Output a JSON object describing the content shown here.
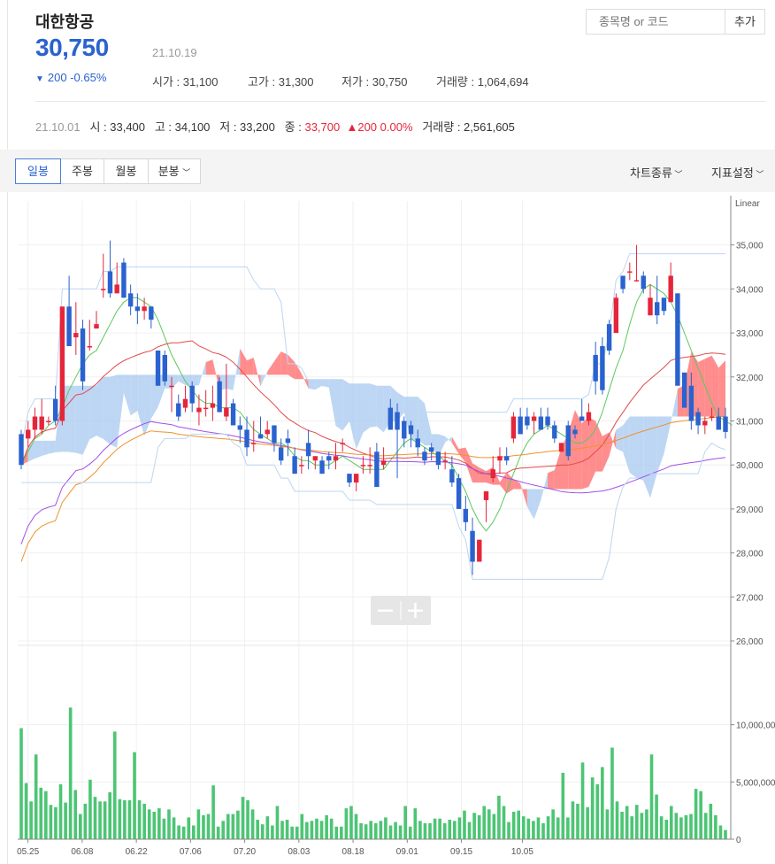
{
  "header": {
    "stock_name": "대한항공",
    "price": "30,750",
    "date": "21.10.19",
    "change": "200 -0.65%",
    "open": "시가 : 31,100",
    "high": "고가 : 31,300",
    "low": "저가 : 30,750",
    "volume": "거래량 : 1,064,694"
  },
  "search": {
    "placeholder": "종목명 or 코드",
    "add_label": "추가"
  },
  "daily": {
    "date": "21.10.01",
    "open": "시 : 33,400",
    "high": "고 : 34,100",
    "low": "저 : 33,200",
    "close_label": "종 : ",
    "close_value": "33,700",
    "change": "▲200 0.00%",
    "volume": "거래량 : 2,561,605"
  },
  "tabs": [
    "일봉",
    "주봉",
    "월봉",
    "분봉"
  ],
  "active_tab": 0,
  "menus": {
    "chart_type": "차트종류",
    "indicator": "지표설정"
  },
  "icons": {
    "down_triangle": "down-triangle-icon",
    "chevron": "chevron-down-icon",
    "zoom_out": "minus-icon",
    "zoom_in": "plus-icon"
  },
  "colors": {
    "up": "#e5263a",
    "down": "#2a62cf",
    "volume": "#4cc574",
    "cloud_up": "#ff7070",
    "cloud_down": "#a7c8f0"
  },
  "chart_data": [
    {
      "type": "candlestick",
      "title": "",
      "scale_label": "Linear",
      "x_tick_labels": [
        "05.25",
        "06.08",
        "06.22",
        "07.06",
        "07.20",
        "08.03",
        "08.18",
        "09.01",
        "09.15",
        "10.05"
      ],
      "x_tick_index": [
        1,
        9,
        17,
        25,
        33,
        41,
        49,
        57,
        65,
        74
      ],
      "y_ticks": [
        26000,
        27000,
        28000,
        29000,
        30000,
        31000,
        32000,
        33000,
        34000,
        35000
      ],
      "ylim": [
        26000,
        36000
      ],
      "ohlc": [
        [
          30700,
          30800,
          29900,
          30000
        ],
        [
          30600,
          31000,
          30400,
          30800
        ],
        [
          30800,
          31300,
          30600,
          31100
        ],
        [
          30800,
          31500,
          30700,
          31100
        ],
        [
          31000,
          31100,
          30900,
          31000
        ],
        [
          31500,
          31800,
          30900,
          31000
        ],
        [
          31000,
          33600,
          30900,
          33600
        ],
        [
          33600,
          34300,
          32700,
          32700
        ],
        [
          32900,
          33700,
          32500,
          33000
        ],
        [
          33100,
          33300,
          31700,
          31900
        ],
        [
          32700,
          33300,
          32600,
          32700
        ],
        [
          33100,
          33500,
          33100,
          33200
        ],
        [
          34000,
          34800,
          33800,
          34000
        ],
        [
          34400,
          35100,
          33800,
          33900
        ],
        [
          33900,
          34600,
          33900,
          34100
        ],
        [
          34600,
          34700,
          33800,
          33800
        ],
        [
          33900,
          34100,
          33400,
          33600
        ],
        [
          33600,
          33900,
          33200,
          33500
        ],
        [
          33500,
          33800,
          33300,
          33600
        ],
        [
          33600,
          33600,
          33100,
          33300
        ],
        [
          32600,
          32600,
          31800,
          31800
        ],
        [
          32500,
          32600,
          31800,
          31900
        ],
        [
          31800,
          32000,
          31200,
          31800
        ],
        [
          31400,
          31600,
          31000,
          31100
        ],
        [
          31300,
          31800,
          31200,
          31500
        ],
        [
          31800,
          31900,
          31200,
          31400
        ],
        [
          31200,
          31600,
          30900,
          31300
        ],
        [
          31300,
          31700,
          31100,
          31300
        ],
        [
          31300,
          31800,
          31000,
          31400
        ],
        [
          31900,
          32000,
          31200,
          31200
        ],
        [
          31100,
          32300,
          31000,
          31300
        ],
        [
          31400,
          31500,
          30900,
          30900
        ],
        [
          30900,
          31100,
          30500,
          30800
        ],
        [
          30800,
          31100,
          30200,
          30400
        ],
        [
          30500,
          31000,
          30300,
          30500
        ],
        [
          30700,
          31100,
          30600,
          30600
        ],
        [
          30700,
          31000,
          30600,
          30800
        ],
        [
          30900,
          30900,
          30300,
          30500
        ],
        [
          30400,
          30600,
          30000,
          30100
        ],
        [
          30600,
          30800,
          30200,
          30500
        ],
        [
          30200,
          30400,
          29800,
          29800
        ],
        [
          30000,
          30200,
          29800,
          30000
        ],
        [
          30500,
          30800,
          29900,
          30200
        ],
        [
          30100,
          30200,
          29900,
          30200
        ],
        [
          30100,
          30200,
          29800,
          29800
        ],
        [
          30200,
          30300,
          29900,
          30100
        ],
        [
          30100,
          30500,
          29900,
          30200
        ],
        [
          30500,
          30600,
          30300,
          30500
        ],
        [
          29800,
          29800,
          29500,
          29600
        ],
        [
          29600,
          29800,
          29400,
          29800
        ],
        [
          30000,
          30200,
          29800,
          30000
        ],
        [
          30000,
          30400,
          29800,
          30000
        ],
        [
          30300,
          30500,
          29500,
          29500
        ],
        [
          30000,
          30400,
          29900,
          30100
        ],
        [
          31300,
          31500,
          30800,
          30800
        ],
        [
          31200,
          31400,
          29700,
          30800
        ],
        [
          31000,
          31100,
          30400,
          30600
        ],
        [
          30900,
          31000,
          30400,
          30700
        ],
        [
          30600,
          30800,
          30200,
          30400
        ],
        [
          30300,
          30400,
          30000,
          30100
        ],
        [
          30400,
          30500,
          30100,
          30300
        ],
        [
          30300,
          30300,
          29900,
          30000
        ],
        [
          30100,
          30300,
          29900,
          30100
        ],
        [
          29900,
          30200,
          29500,
          29600
        ],
        [
          29700,
          29800,
          29000,
          29000
        ],
        [
          29000,
          29300,
          28500,
          28700
        ],
        [
          28500,
          28800,
          27500,
          27800
        ],
        [
          27800,
          28300,
          27800,
          28300
        ],
        [
          29200,
          29400,
          28700,
          29400
        ],
        [
          29700,
          30200,
          29600,
          29900
        ],
        [
          30100,
          30400,
          29800,
          30200
        ],
        [
          30200,
          30400,
          30000,
          30100
        ],
        [
          30600,
          31200,
          30500,
          31100
        ],
        [
          31100,
          31300,
          30700,
          30700
        ],
        [
          31100,
          31300,
          30800,
          30900
        ],
        [
          31000,
          31200,
          30700,
          31100
        ],
        [
          31100,
          31300,
          30900,
          30800
        ],
        [
          31100,
          31300,
          30800,
          30900
        ],
        [
          30900,
          31000,
          30500,
          30600
        ],
        [
          30300,
          30500,
          30300,
          30500
        ],
        [
          30900,
          31000,
          30100,
          30200
        ],
        [
          30800,
          30900,
          30600,
          30700
        ],
        [
          31100,
          31500,
          31000,
          31000
        ],
        [
          31000,
          31400,
          30900,
          31200
        ],
        [
          32500,
          32800,
          31600,
          31900
        ],
        [
          32700,
          32900,
          31600,
          31700
        ],
        [
          33200,
          33300,
          32500,
          32600
        ],
        [
          33000,
          33900,
          33000,
          33800
        ],
        [
          34300,
          34300,
          33900,
          34000
        ],
        [
          34400,
          34600,
          34200,
          34400
        ],
        [
          34200,
          35000,
          34200,
          34200
        ],
        [
          34300,
          34400,
          33900,
          34000
        ],
        [
          33400,
          34100,
          33400,
          33800
        ],
        [
          33700,
          34300,
          33200,
          33400
        ],
        [
          33800,
          33800,
          33400,
          33500
        ],
        [
          33700,
          34600,
          33700,
          34300
        ],
        [
          33900,
          33900,
          32400,
          31800
        ],
        [
          32100,
          32100,
          31300,
          31300
        ],
        [
          31800,
          32100,
          30800,
          31000
        ],
        [
          31200,
          31300,
          30700,
          30900
        ],
        [
          30900,
          31100,
          30700,
          31000
        ],
        [
          31100,
          31300,
          31000,
          31100
        ],
        [
          31100,
          31300,
          30900,
          30800
        ],
        [
          31100,
          31300,
          30600,
          30750
        ]
      ],
      "ma5": [
        30000,
        30300,
        30600,
        30700,
        30900,
        31000,
        31300,
        31700,
        32000,
        32300,
        32500,
        32600,
        32900,
        33200,
        33500,
        33700,
        33800,
        33800,
        33700,
        33600,
        33300,
        32900,
        32500,
        32200,
        31900,
        31700,
        31500,
        31400,
        31400,
        31300,
        31300,
        31300,
        31200,
        31000,
        30800,
        30700,
        30600,
        30500,
        30500,
        30400,
        30200,
        30100,
        30100,
        30000,
        30000,
        30000,
        30100,
        30200,
        30100,
        30000,
        29900,
        29900,
        29900,
        29900,
        30100,
        30300,
        30500,
        30600,
        30500,
        30400,
        30300,
        30200,
        30100,
        30000,
        29700,
        29400,
        29000,
        28700,
        28500,
        28700,
        29000,
        29400,
        29800,
        30200,
        30500,
        30700,
        30800,
        30900,
        30800,
        30700,
        30600,
        30500,
        30500,
        30600,
        30800,
        31200,
        31700,
        32200,
        32600,
        33200,
        33700,
        34000,
        34100,
        34000,
        33900,
        33700,
        33400,
        33000,
        32600,
        32200,
        31800,
        31400,
        31100,
        31000,
        30900
      ]
    },
    {
      "type": "bar",
      "title": "Volume",
      "y_ticks": [
        0,
        5000000,
        10000000
      ],
      "y_tick_labels": [
        "0",
        "5,000,000",
        "10,000,00"
      ],
      "ylim": [
        0,
        15000000
      ],
      "values": [
        9700000,
        4900000,
        3300000,
        7400000,
        4500000,
        4200000,
        3000000,
        2800000,
        4800000,
        3200000,
        11500000,
        4300000,
        2200000,
        3100000,
        5200000,
        3700000,
        3300000,
        3300000,
        4100000,
        9400000,
        3500000,
        3400000,
        3400000,
        7600000,
        3400000,
        3100000,
        2600000,
        2400000,
        2700000,
        1800000,
        2600000,
        1900000,
        1200000,
        1100000,
        1900000,
        1200000,
        2600000,
        2100000,
        2200000,
        4700000,
        1100000,
        1600000,
        2200000,
        2200000,
        2500000,
        3700000,
        3400000,
        2600000,
        1700000,
        1300000,
        2000000,
        1200000,
        2900000,
        1600000,
        1700000,
        1100000,
        1100000,
        2200000,
        1500000,
        1600000,
        1800000,
        1600000,
        2100000,
        1800000,
        1100000,
        1100000,
        2700000,
        2900000,
        2200000,
        1400000,
        1300000,
        1600000,
        1400000,
        1600000,
        1900000,
        1200000,
        1500000,
        1200000,
        2900000,
        1100000,
        2700000,
        1600000,
        1400000,
        1400000,
        1800000,
        1800000,
        1400000,
        1700000,
        1600000,
        1900000,
        2500000,
        1500000,
        2300000,
        2100000,
        2900000,
        2600000,
        2200000,
        3800000,
        2900000,
        1500000,
        2400000,
        2500000,
        2000000,
        1800000,
        1600000,
        1900000,
        1400000,
        2000000,
        2600000,
        1900000,
        5800000,
        1900000,
        3300000,
        3100000,
        6700000,
        2800000,
        5400000,
        4800000,
        6300000,
        2600000,
        8000000,
        3300000,
        2400000,
        2900000,
        2000000,
        3000000,
        2300000,
        2600000,
        7400000,
        3900000,
        2000000,
        1700000,
        2900000,
        2300000,
        1900000,
        2100000,
        2200000,
        4400000,
        4200000,
        2300000,
        3100000,
        2100000,
        1200000,
        800000
      ]
    }
  ]
}
